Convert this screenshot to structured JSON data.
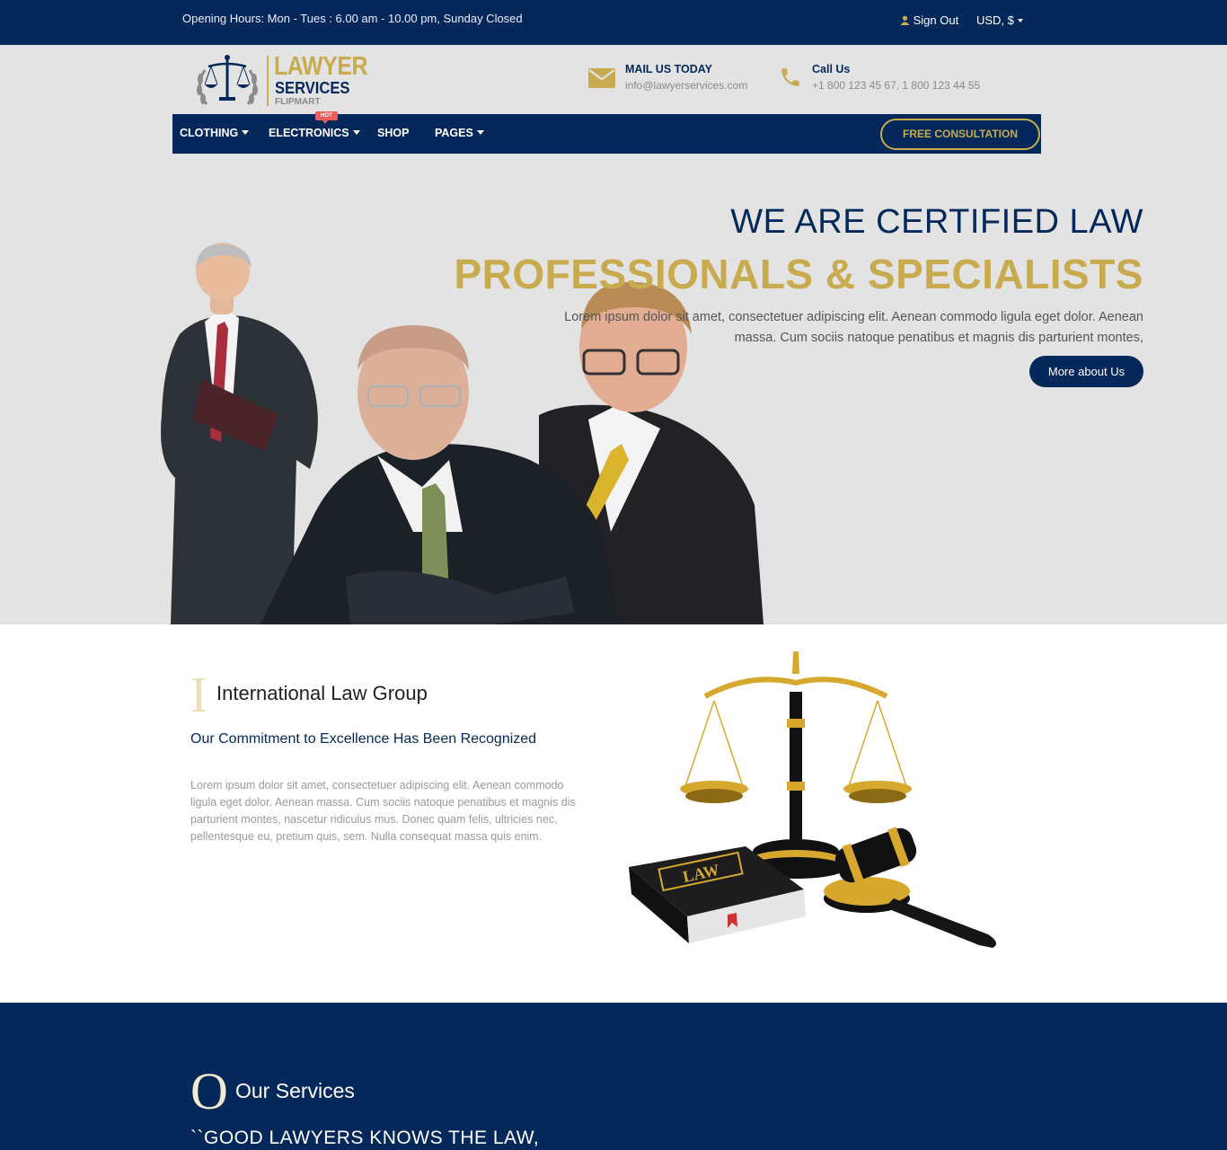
{
  "topbar": {
    "hours": "Opening Hours: Mon - Tues : 6.00 am - 10.00 pm, Sunday Closed",
    "signout": "Sign Out",
    "currency": "USD, $"
  },
  "logo": {
    "line1": "LAWYER",
    "line2": "SERVICES",
    "line3": "FLIPMART"
  },
  "contact": {
    "mail_title": "MAIL US TODAY",
    "mail_value": "info@lawyerservices.com",
    "call_title": "Call Us",
    "call_value": "+1 800 123 45 67, 1 800 123 44 55"
  },
  "nav": {
    "items": [
      "CLOTHING",
      "ELECTRONICS",
      "SHOP",
      "PAGES"
    ],
    "hot_badge": "HOT",
    "consult": "FREE CONSULTATION"
  },
  "hero": {
    "line1": "WE ARE CERTIFIED LAW",
    "line2": "PROFESSIONALS & SPECIALISTS",
    "text": "Lorem ipsum dolor sit amet, consectetuer adipiscing elit. Aenean commodo ligula eget dolor. Aenean massa. Cum sociis natoque penatibus et magnis dis parturient montes,",
    "button": "More about Us"
  },
  "about": {
    "initial": "I",
    "title": "International Law Group",
    "subtitle": "Our Commitment to Excellence Has Been Recognized",
    "text": "Lorem ipsum dolor sit amet, consectetuer adipiscing elit. Aenean commodo ligula eget dolor. Aenean massa. Cum sociis natoque penatibus et magnis dis parturient montes, nascetur ridiculus mus. Donec quam felis, ultricies nec, pellentesque eu, pretium quis, sem. Nulla consequat massa quis enim.",
    "book_label": "LAW"
  },
  "services": {
    "initial": "O",
    "title": "Our Services",
    "quote": "``GOOD LAWYERS KNOWS THE LAW,"
  },
  "colors": {
    "navy": "#05285a",
    "gold": "#c9ab4f",
    "hot": "#ee5d5d"
  }
}
